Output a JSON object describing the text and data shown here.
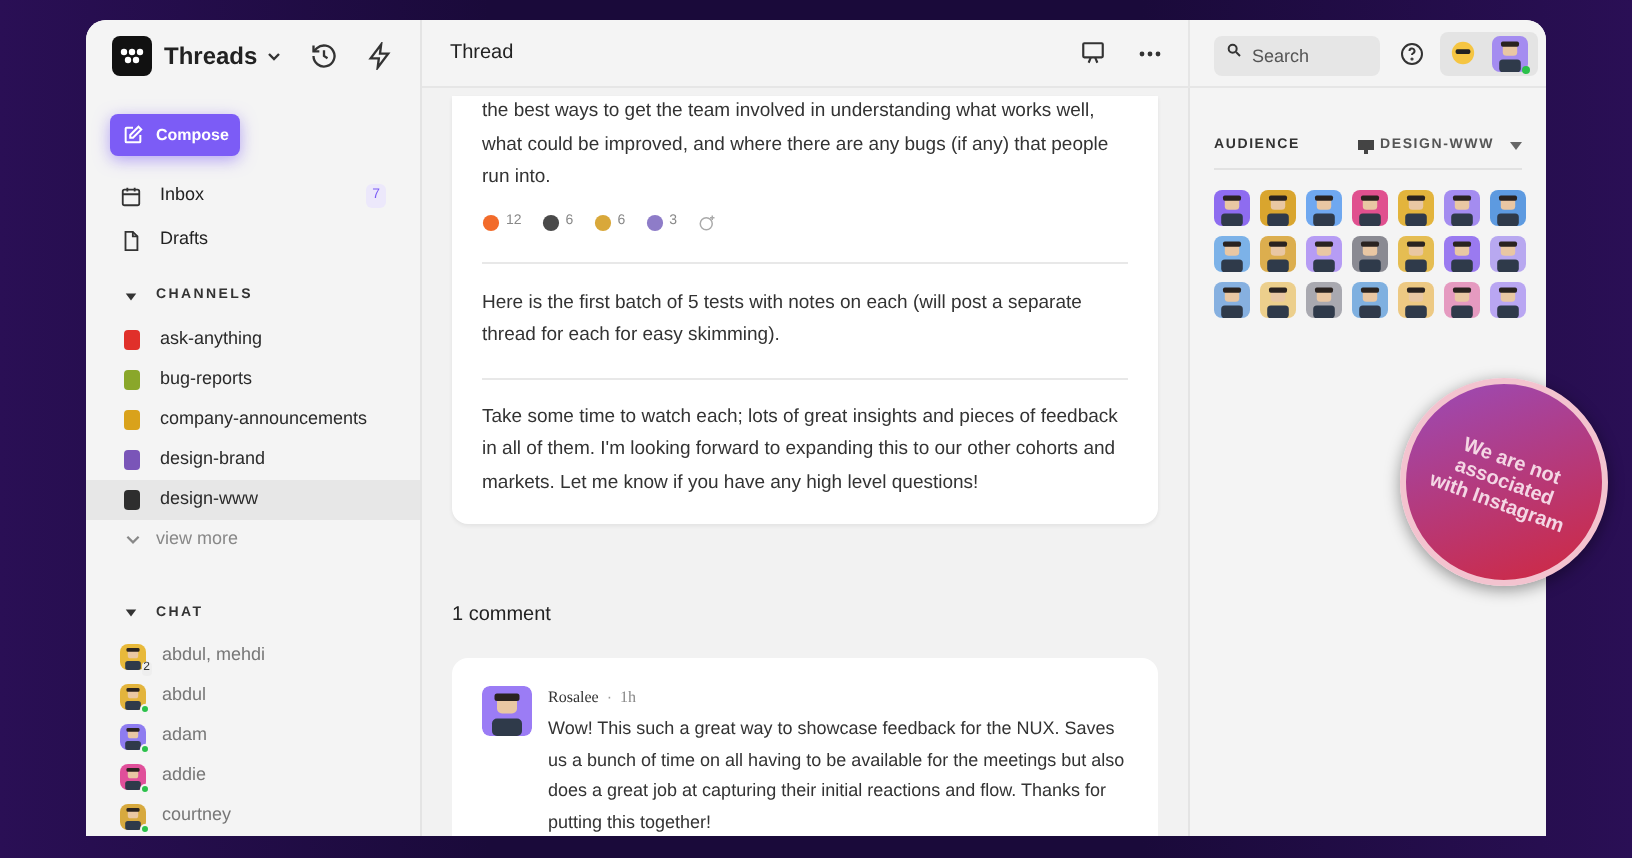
{
  "workspace": {
    "name": "Threads"
  },
  "compose": {
    "label": "Compose"
  },
  "nav": [
    {
      "label": "Inbox",
      "kind": "inbox",
      "count": "7"
    },
    {
      "label": "Drafts",
      "kind": "drafts"
    }
  ],
  "channels": {
    "title": "CHANNELS",
    "expanded": true,
    "items": [
      {
        "name": "ask-anything",
        "color": "#e0302a",
        "selected": false
      },
      {
        "name": "bug-reports",
        "color": "#8aa72a",
        "selected": false
      },
      {
        "name": "company-announcements",
        "color": "#d9a21b",
        "selected": false
      },
      {
        "name": "design-brand",
        "color": "#7a55b8",
        "selected": false
      },
      {
        "name": "design-www",
        "color": "#2e2e2e",
        "selected": true
      }
    ],
    "more": "view more"
  },
  "chat": {
    "title": "CHAT",
    "expanded": true,
    "items": [
      {
        "name": "abdul, mehdi",
        "color": "#e8b93a",
        "online": false,
        "count": "2"
      },
      {
        "name": "abdul",
        "color": "#e3b43c",
        "online": true
      },
      {
        "name": "adam",
        "color": "#8e7cf0",
        "online": true
      },
      {
        "name": "addie",
        "color": "#e04f9a",
        "online": true
      },
      {
        "name": "courtney",
        "color": "#d7a93e",
        "online": true
      }
    ]
  },
  "header": {
    "title": "Thread",
    "search": {
      "placeholder": "Search"
    }
  },
  "post": {
    "paragraphs": [
      "the best ways to get the team involved in understanding what works well, what could be improved, and where there are any bugs (if any) that people run into.",
      "Here is the first batch of 5 tests with notes on each (will post a separate thread for each for easy skimming).",
      "Take some time to watch each; lots of great insights and pieces of feedback in all of them. I'm looking forward to expanding this to our other cohorts and markets. Let me know if you have any high level questions!"
    ],
    "reactions": [
      {
        "count": "12",
        "color": "#f26b2a"
      },
      {
        "count": "6",
        "color": "#4a4a4a"
      },
      {
        "count": "6",
        "color": "#d9a83a"
      },
      {
        "count": "3",
        "color": "#8e7cc8"
      }
    ]
  },
  "comments_title": "1 comment",
  "comment": {
    "author": "Rosalee",
    "time": "1h",
    "sep": "·",
    "text": "Wow! This such a great way to showcase feedback for the NUX. Saves us a bunch of time on all having to be available for the meetings but also does a great job at capturing their initial reactions and flow. Thanks for putting this together!",
    "color": "#9b7cf5"
  },
  "audience": {
    "title": "AUDIENCE",
    "channel": "DESIGN-WWW",
    "members": [
      {
        "color": "#8e6cf0"
      },
      {
        "color": "#d9a52e"
      },
      {
        "color": "#6fa8f0"
      },
      {
        "color": "#e0508f"
      },
      {
        "color": "#e3b43c"
      },
      {
        "color": "#a48cf0"
      },
      {
        "color": "#5d9ae0"
      },
      {
        "color": "#7cb2e8"
      },
      {
        "color": "#dcae4e"
      },
      {
        "color": "#b69cf4"
      },
      {
        "color": "#8a8a92"
      },
      {
        "color": "#e5bd52"
      },
      {
        "color": "#9a7af0"
      },
      {
        "color": "#b8a8f0"
      },
      {
        "color": "#86b0e0"
      },
      {
        "color": "#eccf8c"
      },
      {
        "color": "#a9a9b0"
      },
      {
        "color": "#7fb0e0"
      },
      {
        "color": "#edc983"
      },
      {
        "color": "#e59ac0"
      },
      {
        "color": "#b9a6f2"
      }
    ]
  },
  "user": {
    "online": true
  },
  "sticker": "We are not associated with Instagram"
}
